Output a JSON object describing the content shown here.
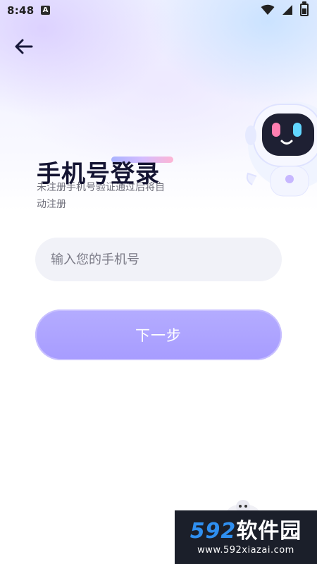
{
  "status_bar": {
    "time": "8:48",
    "notification_icon": "A"
  },
  "header": {
    "back_icon": "arrow-left-icon"
  },
  "page": {
    "title": "手机号登录",
    "subtitle": "未注册手机号验证通过后将自动注册"
  },
  "form": {
    "phone_placeholder": "输入您的手机号",
    "phone_value": "",
    "next_label": "下一步"
  },
  "watermark": {
    "logo_number": "592",
    "logo_text": "软件园",
    "url": "www.592xiazai.com"
  },
  "colors": {
    "accent": "#a99fff",
    "title": "#141432",
    "input_bg": "#f1f2f8"
  }
}
